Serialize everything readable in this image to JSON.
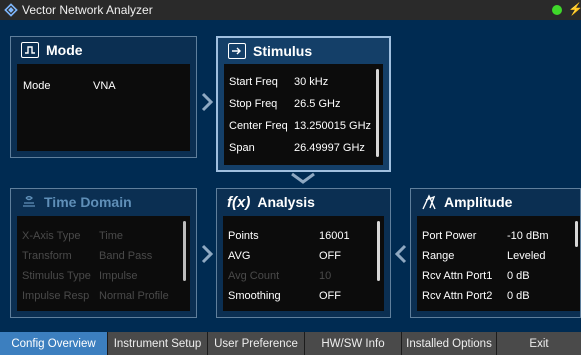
{
  "titlebar": {
    "title": "Vector Network Analyzer",
    "status_color": "#3fd82a",
    "power_icon": "⚡"
  },
  "panels": {
    "mode": {
      "title": "Mode",
      "rows": [
        {
          "k": "Mode",
          "v": "VNA"
        }
      ]
    },
    "stimulus": {
      "title": "Stimulus",
      "rows": [
        {
          "k": "Start Freq",
          "v": "30 kHz"
        },
        {
          "k": "Stop Freq",
          "v": "26.5 GHz"
        },
        {
          "k": "Center Freq",
          "v": "13.250015 GHz"
        },
        {
          "k": "Span",
          "v": "26.49997 GHz"
        }
      ]
    },
    "time_domain": {
      "title": "Time Domain",
      "rows": [
        {
          "k": "X-Axis Type",
          "v": "Time"
        },
        {
          "k": "Transform",
          "v": "Band Pass"
        },
        {
          "k": "Stimulus Type",
          "v": "Impulse"
        },
        {
          "k": "Impulse Resp",
          "v": "Normal Profile"
        }
      ]
    },
    "analysis": {
      "title": "Analysis",
      "icon_text": "f(x)",
      "rows": [
        {
          "k": "Points",
          "v": "16001"
        },
        {
          "k": "AVG",
          "v": "OFF"
        },
        {
          "k": "Avg Count",
          "v": "10"
        },
        {
          "k": "Smoothing",
          "v": "OFF"
        }
      ]
    },
    "amplitude": {
      "title": "Amplitude",
      "rows": [
        {
          "k": "Port Power",
          "v": "-10 dBm"
        },
        {
          "k": "Range",
          "v": "Leveled"
        },
        {
          "k": "Rcv Attn Port1",
          "v": "0 dB"
        },
        {
          "k": "Rcv Attn Port2",
          "v": "0 dB"
        }
      ]
    }
  },
  "tabs": [
    {
      "label": "Config Overview"
    },
    {
      "label": "Instrument Setup"
    },
    {
      "label": "User Preference"
    },
    {
      "label": "HW/SW Info"
    },
    {
      "label": "Installed Options"
    },
    {
      "label": "Exit"
    }
  ]
}
